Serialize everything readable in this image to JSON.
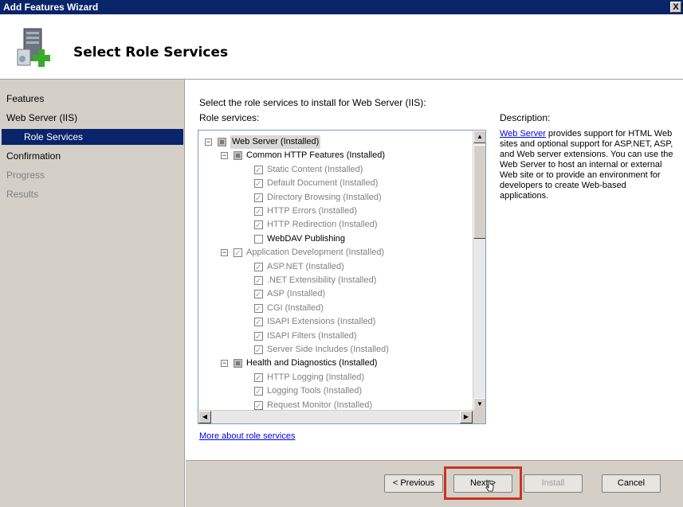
{
  "window": {
    "title": "Add Features Wizard",
    "close_label": "X"
  },
  "header": {
    "page_title": "Select Role Services",
    "logo_icon": "server-add-icon"
  },
  "sidebar": {
    "items": [
      {
        "label": "Features",
        "state": "normal"
      },
      {
        "label": "Web Server (IIS)",
        "state": "normal"
      },
      {
        "label": "Role Services",
        "state": "active"
      },
      {
        "label": "Confirmation",
        "state": "normal"
      },
      {
        "label": "Progress",
        "state": "disabled"
      },
      {
        "label": "Results",
        "state": "disabled"
      }
    ]
  },
  "main": {
    "instruction": "Select the role services to install for Web Server (IIS):",
    "role_services_label": "Role services:",
    "description_label": "Description:",
    "description_link": "Web Server",
    "description_text": " provides support for HTML Web sites and optional support for ASP.NET, ASP, and Web server extensions. You can use the Web Server to host an internal or external Web site or to provide an environment for developers to create Web-based applications.",
    "more_link": "More about role services",
    "tree": [
      {
        "label": "Web Server  (Installed)",
        "expander": "−",
        "check": "gray",
        "level": 0,
        "disabled": false,
        "selected": true
      },
      {
        "label": "Common HTTP Features  (Installed)",
        "expander": "−",
        "check": "gray",
        "level": 1,
        "disabled": false
      },
      {
        "label": "Static Content  (Installed)",
        "check": "checked",
        "level": 2,
        "disabled": true
      },
      {
        "label": "Default Document  (Installed)",
        "check": "checked",
        "level": 2,
        "disabled": true
      },
      {
        "label": "Directory Browsing  (Installed)",
        "check": "checked",
        "level": 2,
        "disabled": true
      },
      {
        "label": "HTTP Errors  (Installed)",
        "check": "checked",
        "level": 2,
        "disabled": true
      },
      {
        "label": "HTTP Redirection  (Installed)",
        "check": "checked",
        "level": 2,
        "disabled": true
      },
      {
        "label": "WebDAV Publishing",
        "check": "unchecked",
        "level": 2,
        "disabled": false
      },
      {
        "label": "Application Development  (Installed)",
        "expander": "−",
        "check": "checked",
        "level": 1,
        "disabled": true
      },
      {
        "label": "ASP.NET  (Installed)",
        "check": "checked",
        "level": 2,
        "disabled": true
      },
      {
        "label": ".NET Extensibility  (Installed)",
        "check": "checked",
        "level": 2,
        "disabled": true
      },
      {
        "label": "ASP  (Installed)",
        "check": "checked",
        "level": 2,
        "disabled": true
      },
      {
        "label": "CGI  (Installed)",
        "check": "checked",
        "level": 2,
        "disabled": true
      },
      {
        "label": "ISAPI Extensions  (Installed)",
        "check": "checked",
        "level": 2,
        "disabled": true
      },
      {
        "label": "ISAPI Filters  (Installed)",
        "check": "checked",
        "level": 2,
        "disabled": true
      },
      {
        "label": "Server Side Includes  (Installed)",
        "check": "checked",
        "level": 2,
        "disabled": true
      },
      {
        "label": "Health and Diagnostics  (Installed)",
        "expander": "−",
        "check": "gray",
        "level": 1,
        "disabled": false
      },
      {
        "label": "HTTP Logging  (Installed)",
        "check": "checked",
        "level": 2,
        "disabled": true
      },
      {
        "label": "Logging Tools  (Installed)",
        "check": "checked",
        "level": 2,
        "disabled": true
      },
      {
        "label": "Request Monitor  (Installed)",
        "check": "checked",
        "level": 2,
        "disabled": true
      }
    ]
  },
  "footer": {
    "previous_label": "< Previous",
    "next_label": "Next >",
    "install_label": "Install",
    "cancel_label": "Cancel"
  },
  "colors": {
    "titlebar": "#0a246a",
    "highlight": "#d03020",
    "link": "#0000ee"
  }
}
